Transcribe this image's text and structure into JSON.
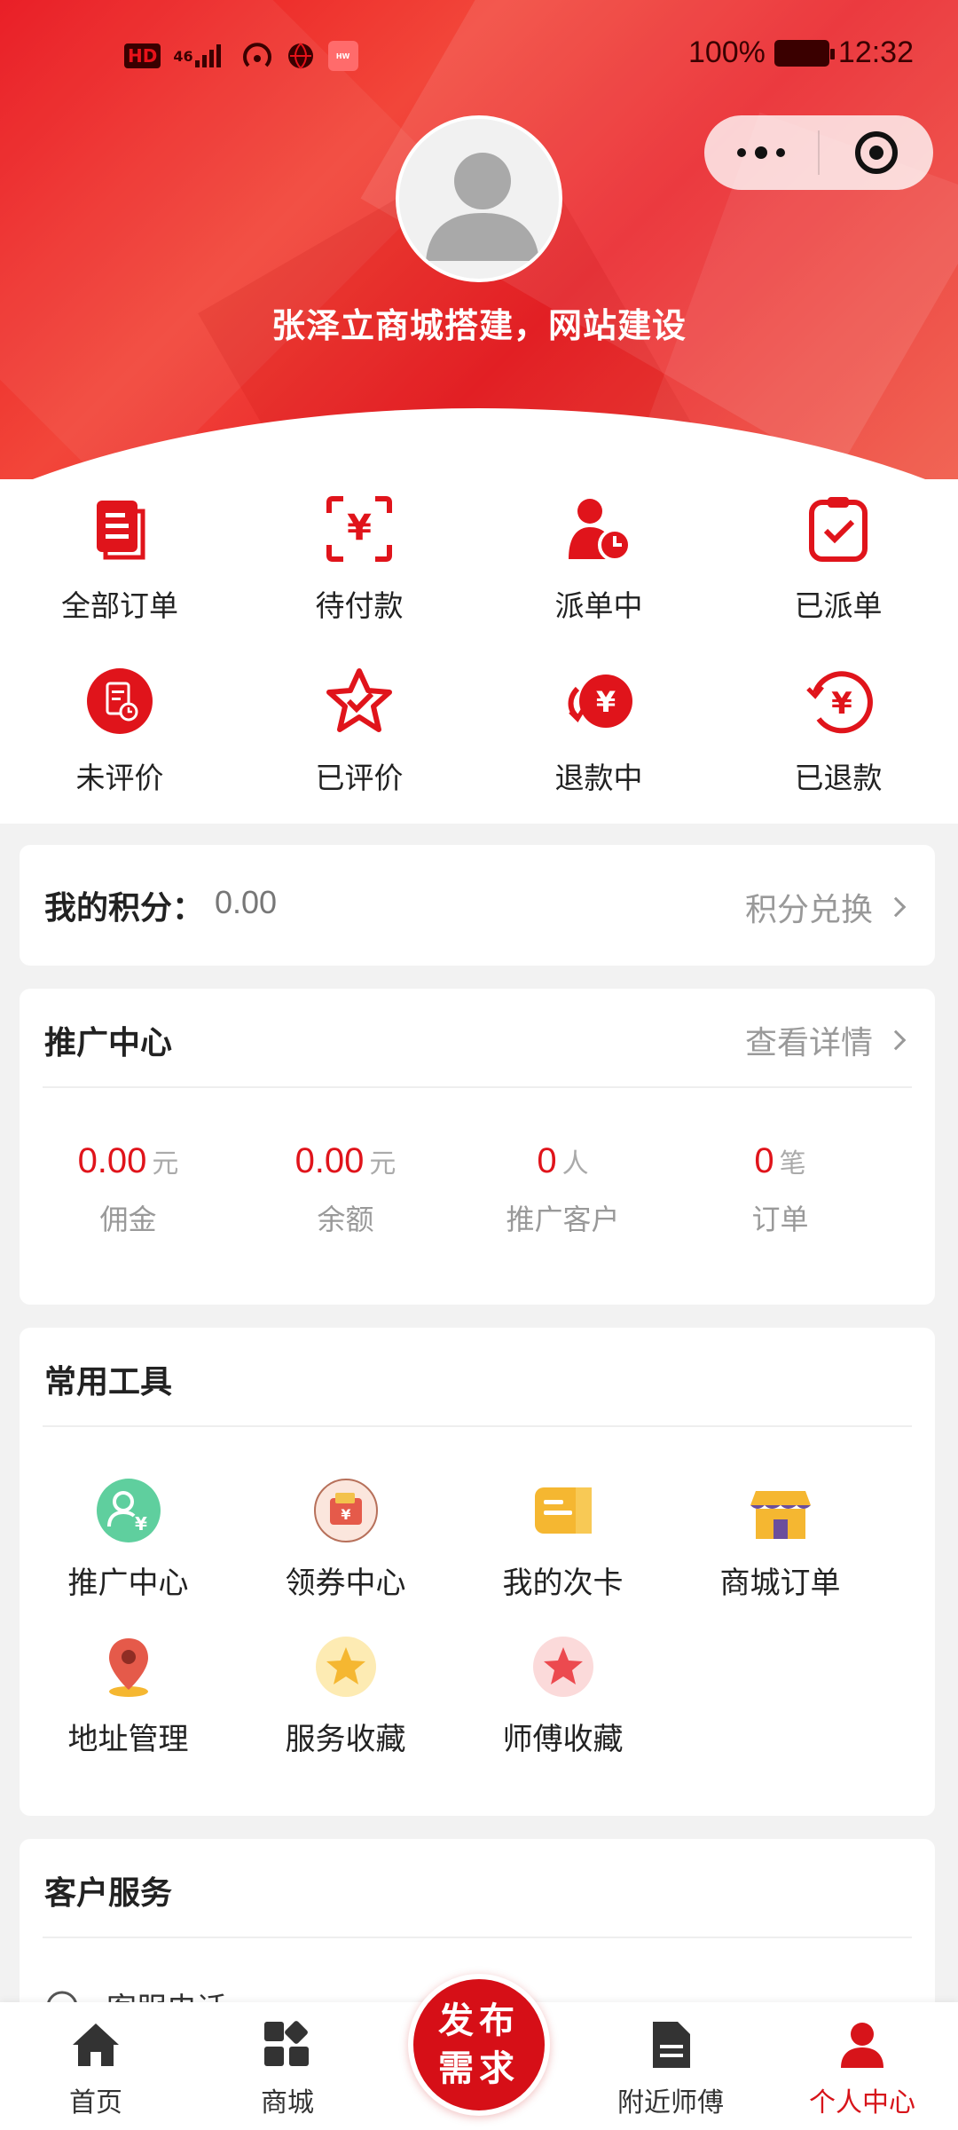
{
  "status_bar": {
    "hd": "HD",
    "network": "46",
    "battery": "100%",
    "time": "12:32"
  },
  "header": {
    "shop_name": "张泽立商城搭建，网站建设"
  },
  "orders": [
    {
      "label": "全部订单",
      "icon": "orders-doc-icon"
    },
    {
      "label": "待付款",
      "icon": "pending-payment-yen-icon"
    },
    {
      "label": "派单中",
      "icon": "dispatching-person-clock-icon"
    },
    {
      "label": "已派单",
      "icon": "dispatched-clipboard-check-icon"
    },
    {
      "label": "未评价",
      "icon": "unrated-doc-clock-icon"
    },
    {
      "label": "已评价",
      "icon": "rated-star-check-icon"
    },
    {
      "label": "退款中",
      "icon": "refunding-yen-icon"
    },
    {
      "label": "已退款",
      "icon": "refunded-yen-icon"
    }
  ],
  "points": {
    "label": "我的积分：",
    "value": "0.00",
    "exchange": "积分兑换"
  },
  "promotion": {
    "title": "推广中心",
    "detail": "查看详情",
    "stats": [
      {
        "value": "0.00",
        "unit": "元",
        "label": "佣金"
      },
      {
        "value": "0.00",
        "unit": "元",
        "label": "余额"
      },
      {
        "value": "0",
        "unit": "人",
        "label": "推广客户"
      },
      {
        "value": "0",
        "unit": "笔",
        "label": "订单"
      }
    ]
  },
  "tools": {
    "title": "常用工具",
    "items": [
      {
        "label": "推广中心",
        "icon": "promo-user-icon"
      },
      {
        "label": "领券中心",
        "icon": "coupon-wallet-icon"
      },
      {
        "label": "我的次卡",
        "icon": "card-icon"
      },
      {
        "label": "商城订单",
        "icon": "shop-store-icon"
      },
      {
        "label": "地址管理",
        "icon": "location-pin-icon"
      },
      {
        "label": "服务收藏",
        "icon": "service-star-icon"
      },
      {
        "label": "师傅收藏",
        "icon": "master-star-icon"
      }
    ]
  },
  "service": {
    "title": "客户服务",
    "first_row": "客服电话"
  },
  "nav": {
    "items": [
      {
        "label": "首页",
        "icon": "home-icon"
      },
      {
        "label": "商城",
        "icon": "mall-grid-icon"
      },
      {
        "label": "附近师傅",
        "icon": "document-icon"
      },
      {
        "label": "个人中心",
        "icon": "person-icon"
      }
    ],
    "publish_line1": "发布",
    "publish_line2": "需求"
  },
  "colors": {
    "brand_red": "#e0141b",
    "header_red": "#e8121a",
    "active_tab": "#d7141a"
  }
}
